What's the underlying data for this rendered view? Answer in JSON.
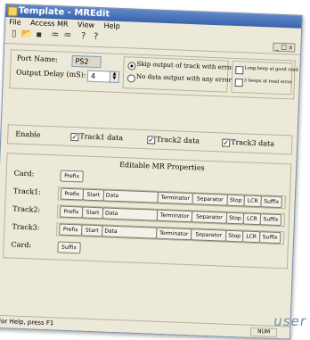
{
  "window": {
    "title": "Template - MREdit",
    "controls": "_ □ x"
  },
  "menu": [
    "File",
    "Access MR",
    "View",
    "Help"
  ],
  "toolbar": {
    "icons": [
      "new-icon",
      "open-icon",
      "save-icon",
      "read-icon",
      "write-icon",
      "help-icon",
      "context-help-icon"
    ],
    "glyphs": [
      "▯",
      "📂",
      "▪",
      "♒",
      "♒",
      "?",
      "?"
    ]
  },
  "settings": {
    "port_label": "Port Name:",
    "port_value": "PS2",
    "delay_label": "Output Delay (mS):",
    "delay_value": "4",
    "radio1": "Skip output of track with error",
    "radio2": "No data output with any error",
    "check1": "Long beep at good read",
    "check2": "3 beeps at read error"
  },
  "enable": {
    "label": "Enable",
    "track1": "Track1 data",
    "track2": "Track2 data",
    "track3": "Track3 data",
    "check_glyph": "✓"
  },
  "props": {
    "title": "Editable MR Properties",
    "card_label": "Card:",
    "prefix_btn": "Prefix",
    "suffix_btn": "Suffix",
    "tracks": [
      {
        "label": "Track1:"
      },
      {
        "label": "Track2:"
      },
      {
        "label": "Track3:"
      }
    ],
    "seg": {
      "prefix": "Prefix",
      "start": "Start",
      "data": "Data",
      "terminator": "Terminator",
      "separator": "Separator",
      "stop": "Stop",
      "lcr": "LCR",
      "suffix": "Suffix"
    }
  },
  "status": {
    "text": "For Help, press F1",
    "num": "NUM"
  },
  "watermark": "user"
}
